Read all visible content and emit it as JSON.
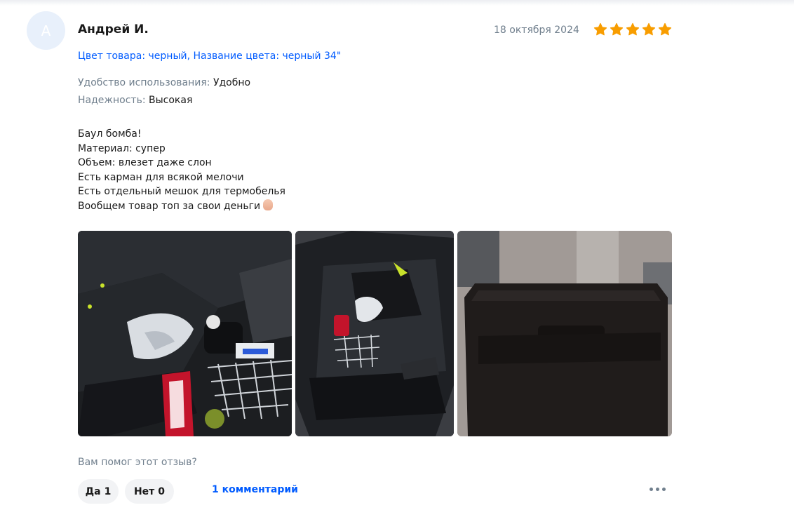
{
  "review": {
    "avatar_initial": "А",
    "author": "Андрей И.",
    "date": "18 октября 2024",
    "rating": 5,
    "star_color": "#f89d00",
    "variant": "Цвет товара: черный, Название цвета: черный 34\"",
    "attributes": [
      {
        "key": "Удобство использования:",
        "value": "Удобно"
      },
      {
        "key": "Надежность:",
        "value": "Высокая"
      }
    ],
    "text_lines": [
      "Баул бомба!",
      "Материал: супер",
      "Объем: влезет даже слон",
      "Есть карман для всякой мелочи",
      "Есть отдельный мешок для термобелья",
      "Вообщем товар топ за свои деньги"
    ],
    "emoji": "pinched-fingers-emoji"
  },
  "photos": [
    {
      "icon": "hockey-gear-photo"
    },
    {
      "icon": "open-bag-photo"
    },
    {
      "icon": "closed-bag-photo"
    }
  ],
  "footer": {
    "helpful_question": "Вам помог этот отзыв?",
    "yes_label": "Да",
    "yes_count": "1",
    "no_label": "Нет",
    "no_count": "0",
    "comments_link": "1 комментарий",
    "more_icon": "more-dots-icon"
  },
  "colors": {
    "accent": "#005bff",
    "muted": "#707f8d",
    "button_bg": "#f2f3f5"
  }
}
